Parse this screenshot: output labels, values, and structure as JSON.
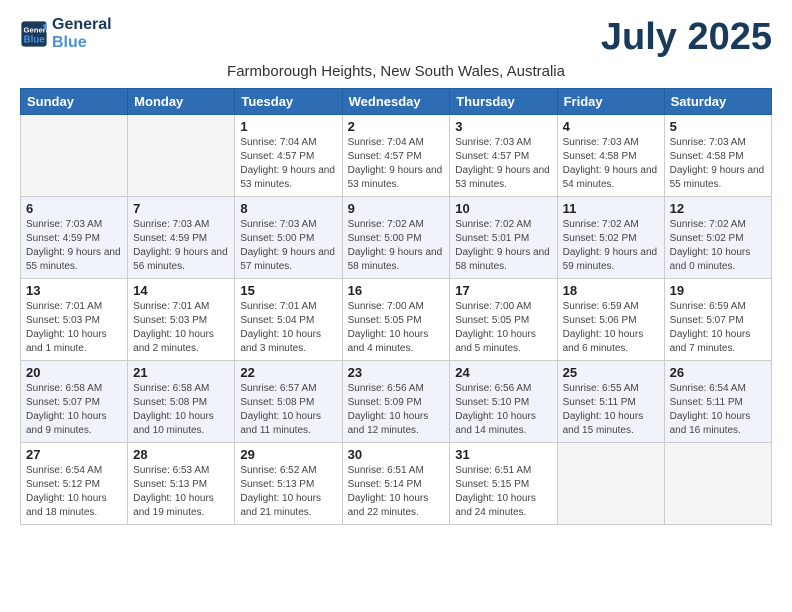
{
  "logo": {
    "line1": "General",
    "line2": "Blue"
  },
  "title": "July 2025",
  "subtitle": "Farmborough Heights, New South Wales, Australia",
  "days_of_week": [
    "Sunday",
    "Monday",
    "Tuesday",
    "Wednesday",
    "Thursday",
    "Friday",
    "Saturday"
  ],
  "weeks": [
    [
      {
        "day": "",
        "empty": true
      },
      {
        "day": "",
        "empty": true
      },
      {
        "day": "1",
        "sunrise": "7:04 AM",
        "sunset": "4:57 PM",
        "daylight": "9 hours and 53 minutes."
      },
      {
        "day": "2",
        "sunrise": "7:04 AM",
        "sunset": "4:57 PM",
        "daylight": "9 hours and 53 minutes."
      },
      {
        "day": "3",
        "sunrise": "7:03 AM",
        "sunset": "4:57 PM",
        "daylight": "9 hours and 53 minutes."
      },
      {
        "day": "4",
        "sunrise": "7:03 AM",
        "sunset": "4:58 PM",
        "daylight": "9 hours and 54 minutes."
      },
      {
        "day": "5",
        "sunrise": "7:03 AM",
        "sunset": "4:58 PM",
        "daylight": "9 hours and 55 minutes."
      }
    ],
    [
      {
        "day": "6",
        "sunrise": "7:03 AM",
        "sunset": "4:59 PM",
        "daylight": "9 hours and 55 minutes."
      },
      {
        "day": "7",
        "sunrise": "7:03 AM",
        "sunset": "4:59 PM",
        "daylight": "9 hours and 56 minutes."
      },
      {
        "day": "8",
        "sunrise": "7:03 AM",
        "sunset": "5:00 PM",
        "daylight": "9 hours and 57 minutes."
      },
      {
        "day": "9",
        "sunrise": "7:02 AM",
        "sunset": "5:00 PM",
        "daylight": "9 hours and 58 minutes."
      },
      {
        "day": "10",
        "sunrise": "7:02 AM",
        "sunset": "5:01 PM",
        "daylight": "9 hours and 58 minutes."
      },
      {
        "day": "11",
        "sunrise": "7:02 AM",
        "sunset": "5:02 PM",
        "daylight": "9 hours and 59 minutes."
      },
      {
        "day": "12",
        "sunrise": "7:02 AM",
        "sunset": "5:02 PM",
        "daylight": "10 hours and 0 minutes."
      }
    ],
    [
      {
        "day": "13",
        "sunrise": "7:01 AM",
        "sunset": "5:03 PM",
        "daylight": "10 hours and 1 minute."
      },
      {
        "day": "14",
        "sunrise": "7:01 AM",
        "sunset": "5:03 PM",
        "daylight": "10 hours and 2 minutes."
      },
      {
        "day": "15",
        "sunrise": "7:01 AM",
        "sunset": "5:04 PM",
        "daylight": "10 hours and 3 minutes."
      },
      {
        "day": "16",
        "sunrise": "7:00 AM",
        "sunset": "5:05 PM",
        "daylight": "10 hours and 4 minutes."
      },
      {
        "day": "17",
        "sunrise": "7:00 AM",
        "sunset": "5:05 PM",
        "daylight": "10 hours and 5 minutes."
      },
      {
        "day": "18",
        "sunrise": "6:59 AM",
        "sunset": "5:06 PM",
        "daylight": "10 hours and 6 minutes."
      },
      {
        "day": "19",
        "sunrise": "6:59 AM",
        "sunset": "5:07 PM",
        "daylight": "10 hours and 7 minutes."
      }
    ],
    [
      {
        "day": "20",
        "sunrise": "6:58 AM",
        "sunset": "5:07 PM",
        "daylight": "10 hours and 9 minutes."
      },
      {
        "day": "21",
        "sunrise": "6:58 AM",
        "sunset": "5:08 PM",
        "daylight": "10 hours and 10 minutes."
      },
      {
        "day": "22",
        "sunrise": "6:57 AM",
        "sunset": "5:08 PM",
        "daylight": "10 hours and 11 minutes."
      },
      {
        "day": "23",
        "sunrise": "6:56 AM",
        "sunset": "5:09 PM",
        "daylight": "10 hours and 12 minutes."
      },
      {
        "day": "24",
        "sunrise": "6:56 AM",
        "sunset": "5:10 PM",
        "daylight": "10 hours and 14 minutes."
      },
      {
        "day": "25",
        "sunrise": "6:55 AM",
        "sunset": "5:11 PM",
        "daylight": "10 hours and 15 minutes."
      },
      {
        "day": "26",
        "sunrise": "6:54 AM",
        "sunset": "5:11 PM",
        "daylight": "10 hours and 16 minutes."
      }
    ],
    [
      {
        "day": "27",
        "sunrise": "6:54 AM",
        "sunset": "5:12 PM",
        "daylight": "10 hours and 18 minutes."
      },
      {
        "day": "28",
        "sunrise": "6:53 AM",
        "sunset": "5:13 PM",
        "daylight": "10 hours and 19 minutes."
      },
      {
        "day": "29",
        "sunrise": "6:52 AM",
        "sunset": "5:13 PM",
        "daylight": "10 hours and 21 minutes."
      },
      {
        "day": "30",
        "sunrise": "6:51 AM",
        "sunset": "5:14 PM",
        "daylight": "10 hours and 22 minutes."
      },
      {
        "day": "31",
        "sunrise": "6:51 AM",
        "sunset": "5:15 PM",
        "daylight": "10 hours and 24 minutes."
      },
      {
        "day": "",
        "empty": true
      },
      {
        "day": "",
        "empty": true
      }
    ]
  ]
}
